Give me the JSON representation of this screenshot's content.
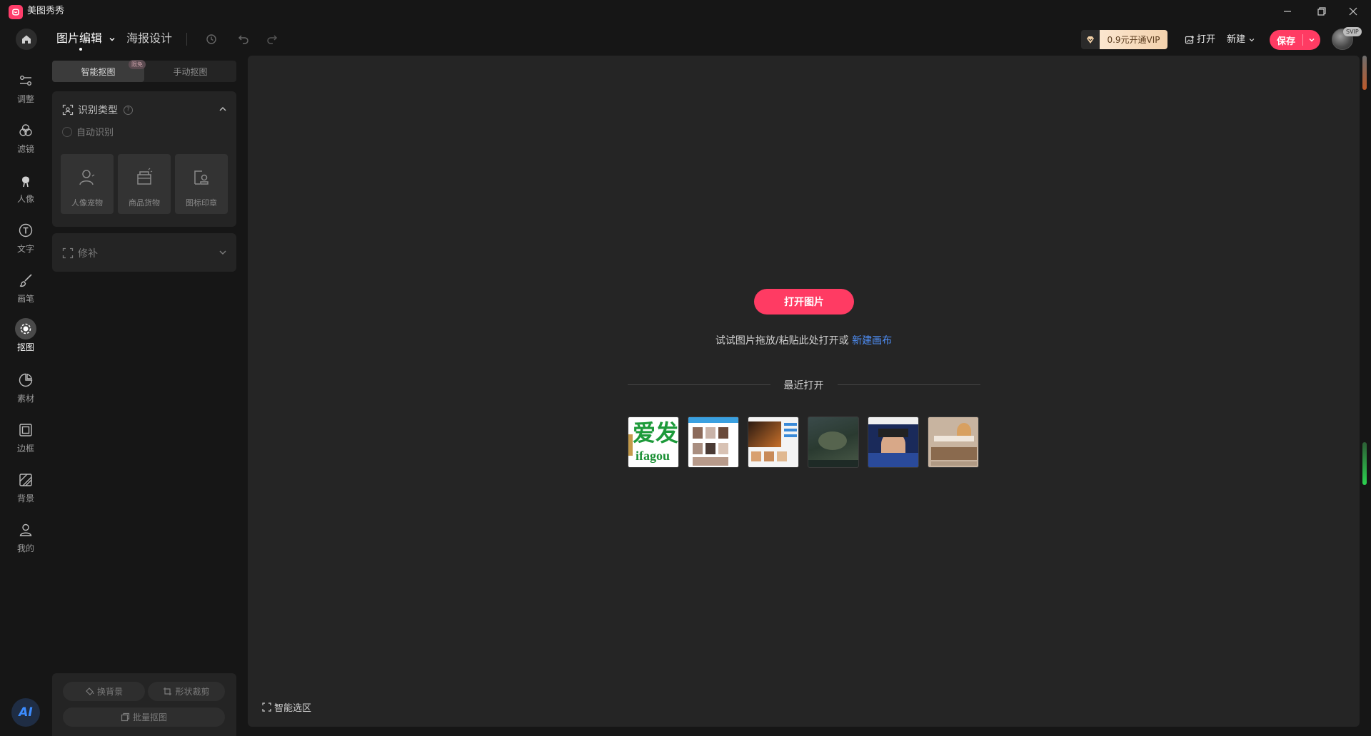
{
  "app": {
    "title": "美图秀秀"
  },
  "toolbar": {
    "tabs": [
      {
        "label": "图片编辑",
        "active": true,
        "has_dropdown": true
      },
      {
        "label": "海报设计",
        "active": false
      }
    ],
    "vip_label": "0.9元开通VIP",
    "open_label": "打开",
    "new_label": "新建",
    "save_label": "保存",
    "avatar_badge": "SVIP"
  },
  "rail": {
    "items": [
      {
        "label": "调整",
        "icon": "sliders-icon"
      },
      {
        "label": "滤镜",
        "icon": "filter-icon"
      },
      {
        "label": "人像",
        "icon": "portrait-icon"
      },
      {
        "label": "文字",
        "icon": "text-icon"
      },
      {
        "label": "画笔",
        "icon": "brush-icon"
      },
      {
        "label": "抠图",
        "icon": "cutout-icon",
        "active": true
      },
      {
        "label": "素材",
        "icon": "sticker-icon"
      },
      {
        "label": "边框",
        "icon": "frame-icon"
      },
      {
        "label": "背景",
        "icon": "background-icon"
      },
      {
        "label": "我的",
        "icon": "user-icon"
      }
    ],
    "ai_label": "AI"
  },
  "panel": {
    "tabs": [
      {
        "label": "智能抠图",
        "active": true
      },
      {
        "label": "手动抠图",
        "active": false
      }
    ],
    "badge": "限免",
    "recognition": {
      "title": "识别类型",
      "auto_label": "自动识别",
      "types": [
        {
          "label": "人像宠物"
        },
        {
          "label": "商品货物"
        },
        {
          "label": "图标印章"
        }
      ]
    },
    "repair": {
      "title": "修补"
    },
    "bottom": {
      "replace_bg": "换背景",
      "shape_crop": "形状裁剪",
      "batch_cutout": "批量抠图"
    }
  },
  "canvas": {
    "open_button": "打开图片",
    "hint_text": "试试图片拖放/粘贴此处打开或 ",
    "hint_link": "新建画布",
    "recent_title": "最近打开",
    "smart_select": "智能选区",
    "recent_thumbs": [
      {
        "caption_top": "爱发",
        "caption_bottom": "ifagou"
      },
      {
        "caption_top": "",
        "caption_bottom": ""
      },
      {
        "caption_top": "",
        "caption_bottom": ""
      },
      {
        "caption_top": "",
        "caption_bottom": ""
      },
      {
        "caption_top": "",
        "caption_bottom": ""
      },
      {
        "caption_top": "",
        "caption_bottom": ""
      }
    ]
  },
  "colors": {
    "accent": "#ff3b63",
    "link": "#4f8ff7",
    "background": "#161616",
    "canvas": "#252525"
  }
}
